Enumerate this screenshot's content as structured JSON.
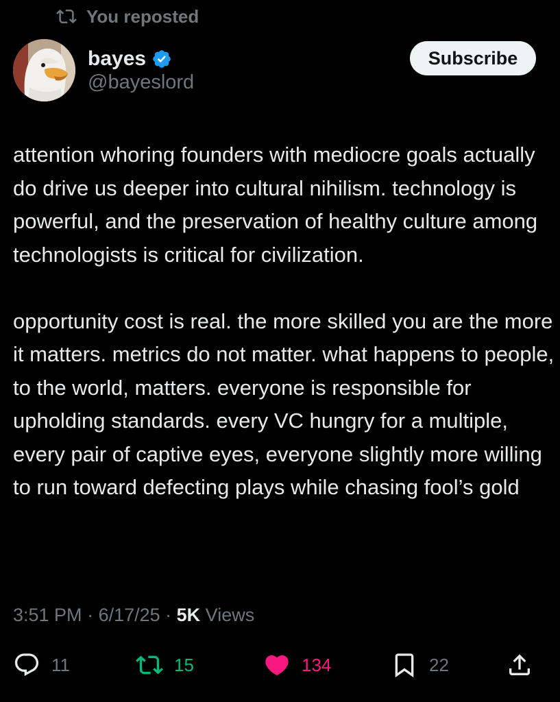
{
  "repost_banner": {
    "label": "You reposted"
  },
  "author": {
    "display_name": "bayes",
    "handle": "@bayeslord",
    "verified": true,
    "verified_color": "#1d9bf0"
  },
  "subscribe_button": {
    "label": "Subscribe"
  },
  "post": {
    "paragraphs": [
      "attention whoring founders with mediocre goals actually do drive us deeper into cultural nihilism. technology is powerful, and the preservation of healthy culture among technologists is critical for civilization.",
      "opportunity cost is real. the more skilled you are the more it matters. metrics do not matter. what happens to people, to the world, matters. everyone is responsible for upholding standards. every VC hungry for a multiple, every pair of captive eyes, everyone slightly more willing to run toward defecting plays while chasing fool’s gold"
    ]
  },
  "meta": {
    "time": "3:51 PM",
    "separator": " · ",
    "date": "6/17/25",
    "views_count": "5K",
    "views_label": " Views"
  },
  "actions": {
    "reply_count": "11",
    "repost_count": "15",
    "like_count": "134",
    "bookmark_count": "22"
  },
  "colors": {
    "background": "#000000",
    "primary_text": "#e7e9ea",
    "secondary_text": "#71767b",
    "repost_active": "#00ba7c",
    "like_active": "#f91880"
  }
}
